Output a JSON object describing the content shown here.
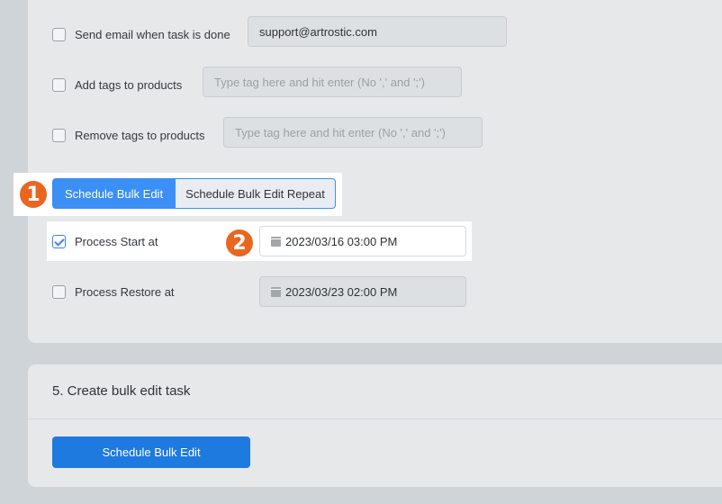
{
  "email_row": {
    "label": "Send email when task is done",
    "value": "support@artrostic.com",
    "checked": false
  },
  "add_tags_row": {
    "label": "Add tags to products",
    "placeholder": "Type tag here and hit enter (No ',' and ';')",
    "checked": false
  },
  "remove_tags_row": {
    "label": "Remove tags to products",
    "placeholder": "Type tag here and hit enter (No ',' and ';')",
    "checked": false
  },
  "schedule_toggle": {
    "active_label": "Schedule Bulk Edit",
    "inactive_label": "Schedule Bulk Edit Repeat"
  },
  "badges": {
    "one": "1",
    "two": "2"
  },
  "process_start": {
    "label": "Process Start at",
    "value": "2023/03/16 03:00 PM",
    "checked": true
  },
  "process_restore": {
    "label": "Process Restore at",
    "value": "2023/03/23 02:00 PM",
    "checked": false
  },
  "section5": {
    "title": "5. Create bulk edit task",
    "button_label": "Schedule Bulk Edit"
  },
  "colors": {
    "accent": "#3b8ff5",
    "primary_button": "#1f7ae0",
    "badge": "#e8661f"
  },
  "icons": {
    "date": "calendar-icon",
    "check": "checkmark-icon"
  }
}
